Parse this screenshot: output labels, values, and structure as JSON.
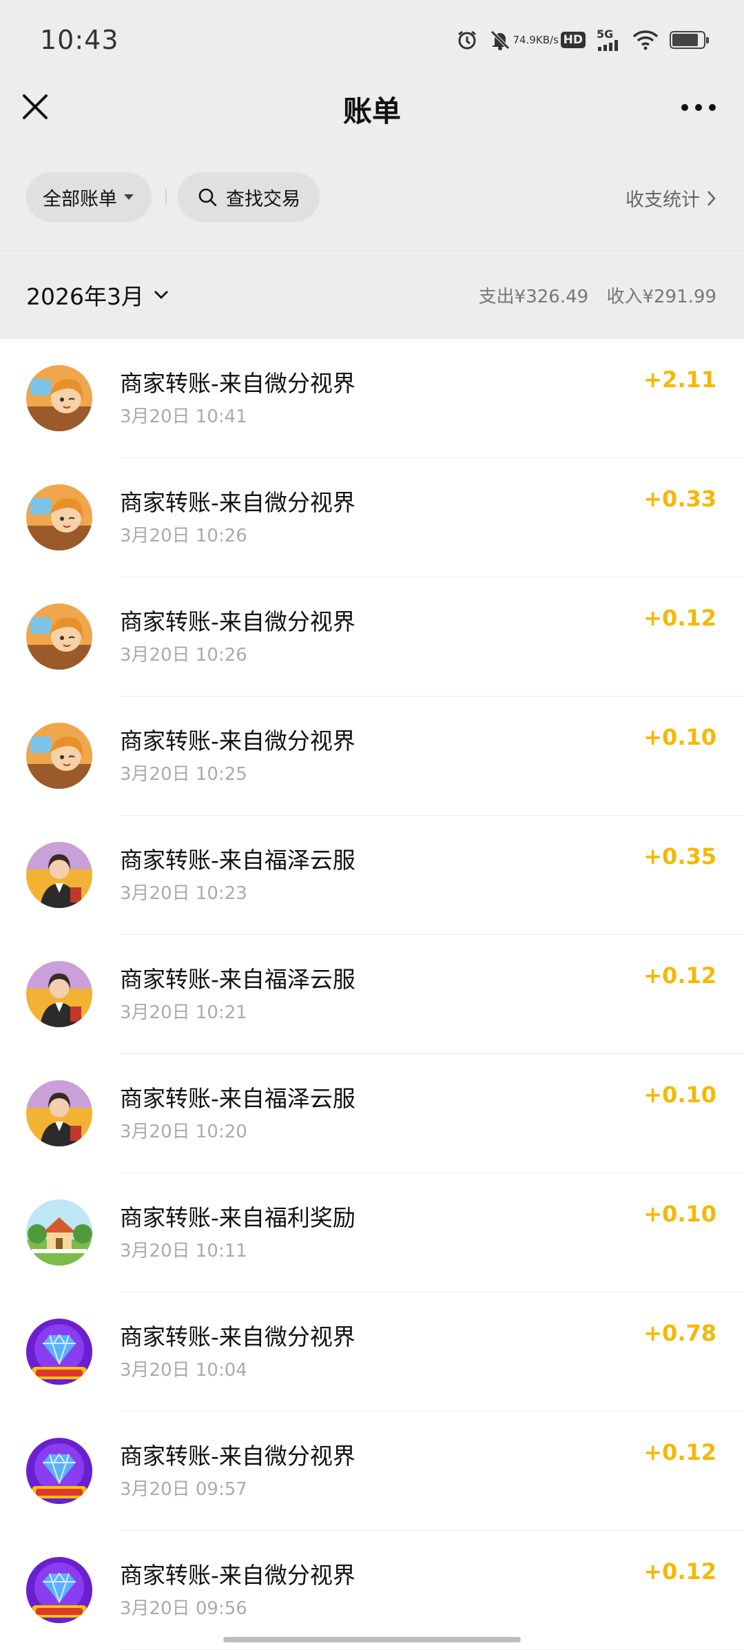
{
  "status_bar": {
    "time": "10:43",
    "net_speed_value": "74.9",
    "net_speed_unit": "KB/s",
    "hd": "HD",
    "network": "5G",
    "battery_level": 0.85
  },
  "nav": {
    "title": "账单"
  },
  "filters": {
    "all_bills": "全部账单",
    "search": "查找交易",
    "stats": "收支统计"
  },
  "month": {
    "label": "2026年3月",
    "expense": "支出¥326.49",
    "income": "收入¥291.99"
  },
  "colors": {
    "amount": "#f5b800",
    "header_bg": "#ededed"
  },
  "transactions": [
    {
      "title": "商家转账-来自微分视界",
      "time": "3月20日 10:41",
      "amount": "+2.11",
      "avatar": "game-girl-avatar"
    },
    {
      "title": "商家转账-来自微分视界",
      "time": "3月20日 10:26",
      "amount": "+0.33",
      "avatar": "game-girl-avatar"
    },
    {
      "title": "商家转账-来自微分视界",
      "time": "3月20日 10:26",
      "amount": "+0.12",
      "avatar": "game-girl-avatar"
    },
    {
      "title": "商家转账-来自微分视界",
      "time": "3月20日 10:25",
      "amount": "+0.10",
      "avatar": "game-girl-avatar"
    },
    {
      "title": "商家转账-来自福泽云服",
      "time": "3月20日 10:23",
      "amount": "+0.35",
      "avatar": "businesswoman-avatar"
    },
    {
      "title": "商家转账-来自福泽云服",
      "time": "3月20日 10:21",
      "amount": "+0.12",
      "avatar": "businesswoman-avatar"
    },
    {
      "title": "商家转账-来自福泽云服",
      "time": "3月20日 10:20",
      "amount": "+0.10",
      "avatar": "businesswoman-avatar"
    },
    {
      "title": "商家转账-来自福利奖励",
      "time": "3月20日 10:11",
      "amount": "+0.10",
      "avatar": "cottage-avatar"
    },
    {
      "title": "商家转账-来自微分视界",
      "time": "3月20日 10:04",
      "amount": "+0.78",
      "avatar": "diamond-avatar"
    },
    {
      "title": "商家转账-来自微分视界",
      "time": "3月20日 09:57",
      "amount": "+0.12",
      "avatar": "diamond-avatar"
    },
    {
      "title": "商家转账-来自微分视界",
      "time": "3月20日 09:56",
      "amount": "+0.12",
      "avatar": "diamond-avatar"
    }
  ]
}
